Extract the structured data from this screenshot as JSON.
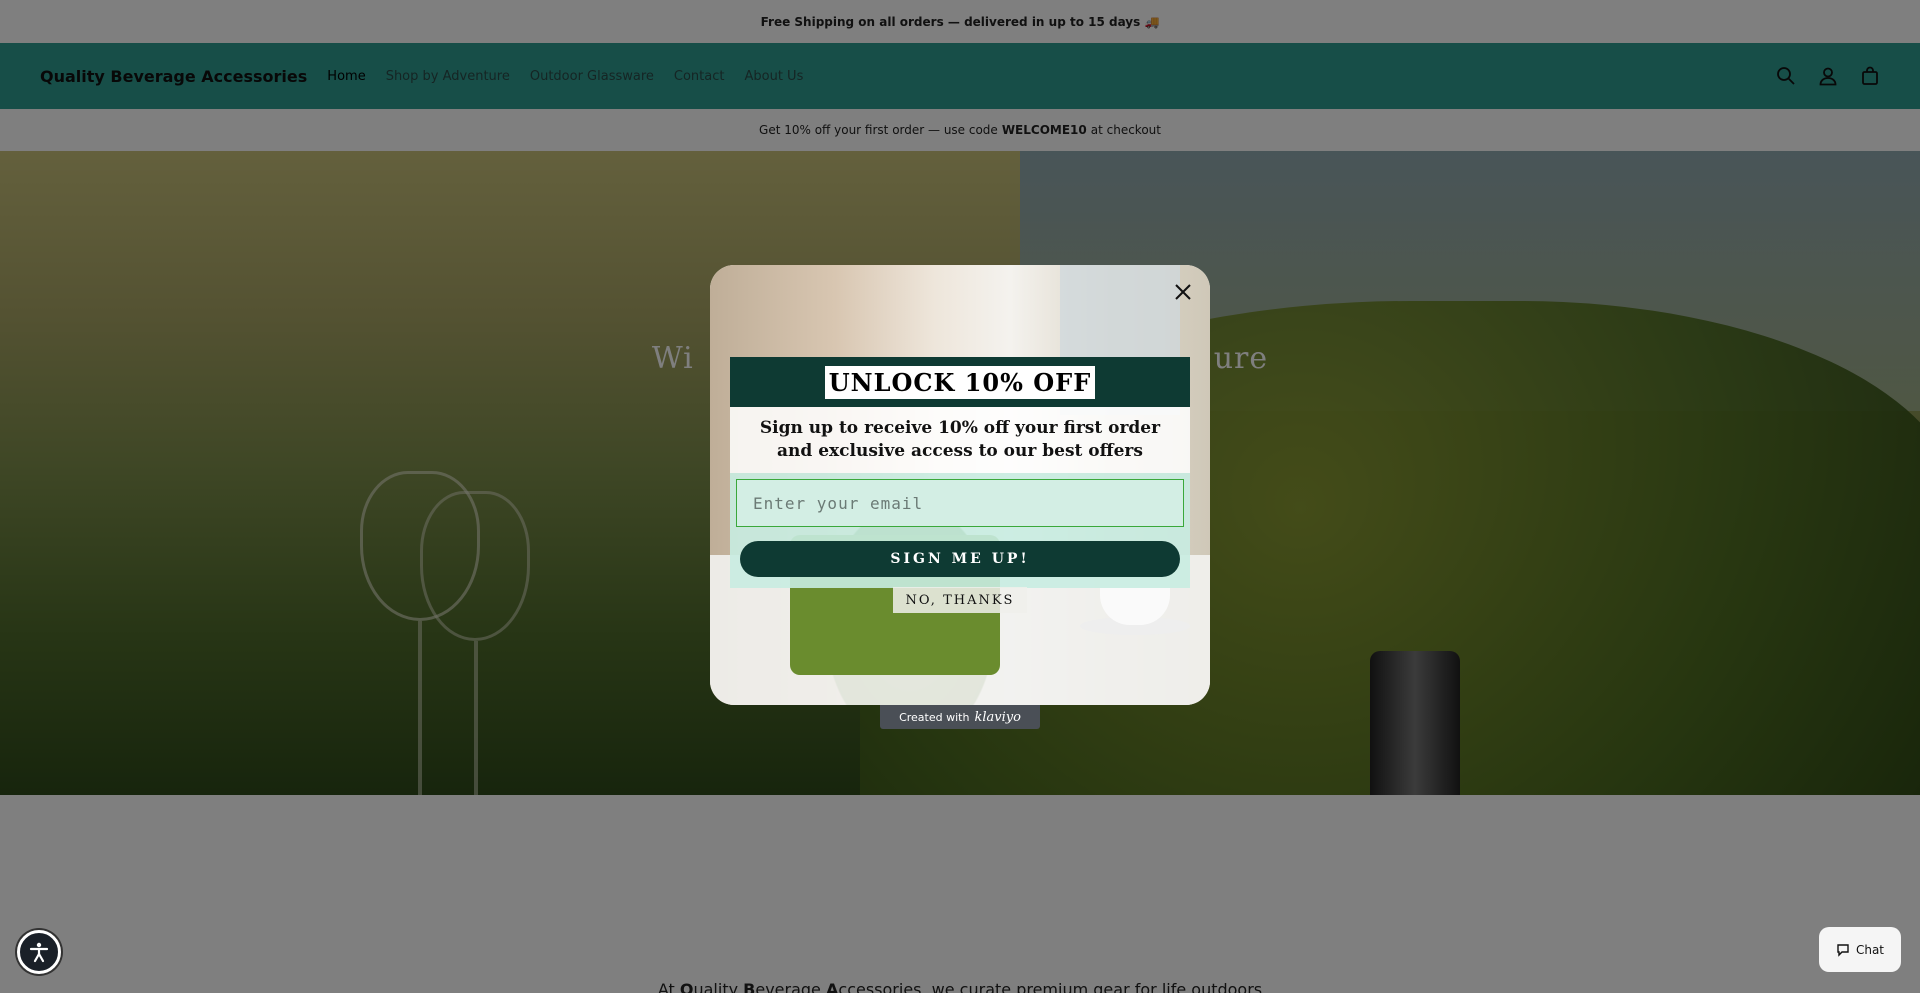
{
  "announcement": {
    "text": "Free Shipping on all orders — delivered in up to 15 days 🚚"
  },
  "header": {
    "brand": "Quality Beverage Accessories",
    "nav": [
      {
        "label": "Home"
      },
      {
        "label": "Shop by Adventure"
      },
      {
        "label": "Outdoor Glassware"
      },
      {
        "label": "Contact"
      },
      {
        "label": "About Us"
      }
    ],
    "icons": [
      "search-icon",
      "account-icon",
      "cart-icon"
    ]
  },
  "promo": {
    "prefix": "Get 10% off your first order — use code",
    "code": "WELCOME10",
    "suffix": "at checkout"
  },
  "hero": {
    "title_left": "Wi",
    "title_right": "ure"
  },
  "about": {
    "lead": "At",
    "q": "Q",
    "uality": "uality",
    "b": "B",
    "everage": "everage",
    "a": "A",
    "rest": "ccessories, we curate premium gear for life outdoors"
  },
  "popup": {
    "headline": "UNLOCK 10% OFF",
    "subtitle_line1": "Sign up to receive 10% off your first order",
    "subtitle_line2": "and exclusive access to our best offers",
    "email_placeholder": "Enter your email",
    "signup_label": "SIGN ME UP!",
    "no_thanks_label": "NO, THANKS",
    "close_icon": "close-icon"
  },
  "klaviyo": {
    "prefix": "Created with",
    "brand": "klaviyo"
  },
  "chat": {
    "label": "Chat"
  },
  "colors": {
    "header_bg": "#2f9c91",
    "popup_dark": "#0e3a33",
    "form_bg": "#c8ece1",
    "input_border": "#3aa83a"
  }
}
